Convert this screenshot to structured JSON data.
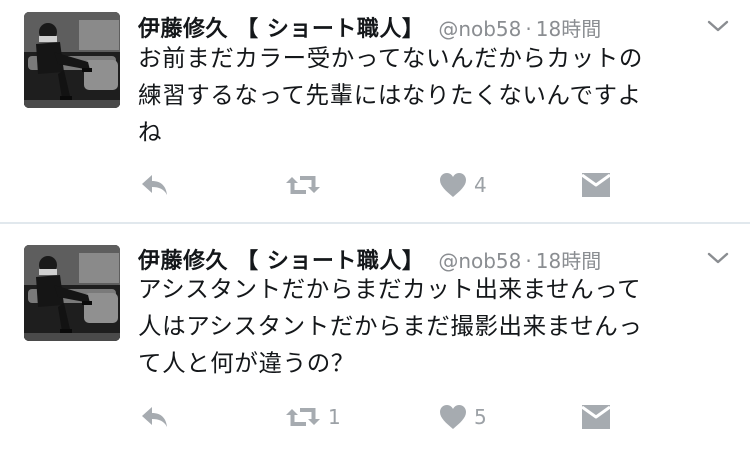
{
  "tweets": [
    {
      "display_name": "伊藤修久 【 ショート職人】",
      "handle": "@nob58",
      "separator": "·",
      "timestamp": "18時間",
      "text": "お前まだカラー受かってないんだからカットの\n練習するなって先輩にはなりたくないんですよ\nね",
      "retweet_count": "",
      "like_count": "4",
      "icons": [
        "chevron-down-icon",
        "reply-icon",
        "retweet-icon",
        "heart-icon",
        "direct-message-icon"
      ]
    },
    {
      "display_name": "伊藤修久 【 ショート職人】",
      "handle": "@nob58",
      "separator": "·",
      "timestamp": "18時間",
      "text": "アシスタントだからまだカット出来ませんって\n人はアシスタントだからまだ撮影出来ませんっ\nて人と何が違うの？",
      "retweet_count": "1",
      "like_count": "5",
      "icons": [
        "chevron-down-icon",
        "reply-icon",
        "retweet-icon",
        "heart-icon",
        "direct-message-icon"
      ]
    }
  ],
  "colors": {
    "text": "#14171a",
    "secondary": "#8a8d91",
    "icon": "#a6abb0",
    "divider": "#e1e8ed"
  }
}
